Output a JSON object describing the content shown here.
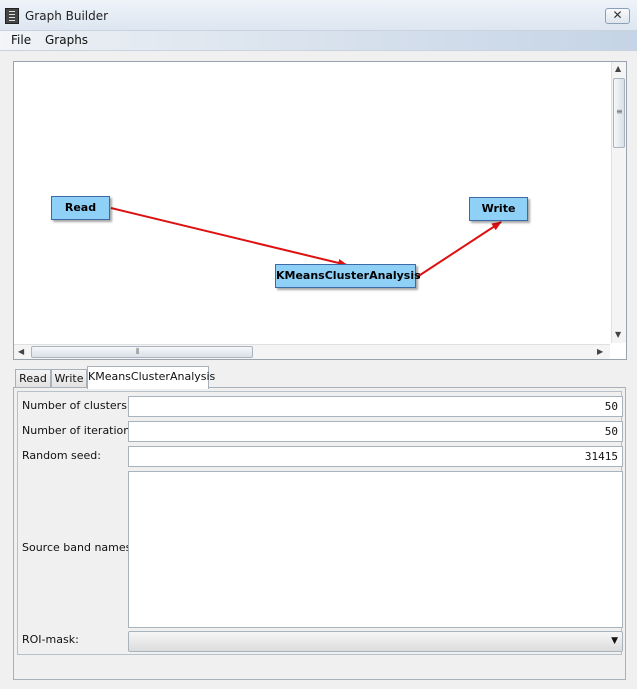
{
  "window": {
    "title": "Graph Builder",
    "close_glyph": "✕"
  },
  "menu": {
    "items": [
      "File",
      "Graphs"
    ]
  },
  "graph": {
    "nodes": [
      {
        "id": "read",
        "label": "Read"
      },
      {
        "id": "kmeans",
        "label": "KMeansClusterAnalysis"
      },
      {
        "id": "write",
        "label": "Write"
      }
    ],
    "edges": [
      {
        "from": "Read",
        "to": "KMeansClusterAnalysis"
      },
      {
        "from": "KMeansClusterAnalysis",
        "to": "Write"
      }
    ],
    "edge_color": "#dd1111",
    "node_color": "#8fd0f7"
  },
  "tabs": [
    {
      "label": "Read",
      "active": false
    },
    {
      "label": "Write",
      "active": false
    },
    {
      "label": "KMeansClusterAnalysis",
      "active": true
    }
  ],
  "form": {
    "num_clusters": {
      "label": "Number of clusters:",
      "value": "50"
    },
    "num_iterations": {
      "label": "Number of iterations:",
      "value": "50"
    },
    "random_seed": {
      "label": "Random seed:",
      "value": "31415"
    },
    "source_bands": {
      "label": "Source band names:",
      "value": ""
    },
    "roi_mask": {
      "label": "ROI-mask:",
      "value": ""
    }
  }
}
